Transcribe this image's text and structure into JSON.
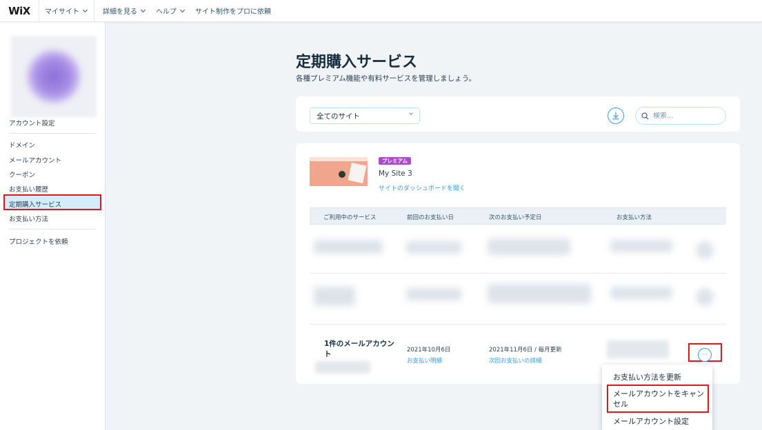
{
  "topbar": {
    "logo": "WiX",
    "my_sites": "マイサイト",
    "explore": "詳細を見る",
    "help": "ヘルプ",
    "hire": "サイト制作をプロに依頼"
  },
  "sidebar": {
    "account_settings": "アカウント設定",
    "items": [
      "ドメイン",
      "メールアカウント",
      "クーポン",
      "お支払い履歴",
      "定期購入サービス",
      "お支払い方法"
    ],
    "hire_project": "プロジェクトを依頼"
  },
  "page": {
    "title": "定期購入サービス",
    "subtitle": "各種プレミアム機能や有料サービスを管理しましょう。"
  },
  "filter": {
    "site_select": "全てのサイト",
    "search_placeholder": "検索..."
  },
  "site": {
    "badge": "プレミアム",
    "name": "My Site 3",
    "dashboard_link": "サイトのダッシュボードを開く"
  },
  "table": {
    "headers": [
      "ご利用中のサービス",
      "前回のお支払い日",
      "次のお支払い予定日",
      "お支払い方法"
    ]
  },
  "mail_row": {
    "service": "1件のメールアカウント",
    "last_payment": "2021年10月6日",
    "last_payment_link": "お支払い明細",
    "next_payment": "2021年11月6日 / 毎月更新",
    "next_payment_link": "次回お支払いの詳細",
    "more": "···"
  },
  "menu": {
    "items": [
      "お支払い方法を更新",
      "メールアカウントをキャンセル",
      "メールアカウント設定"
    ]
  },
  "colors": {
    "accent": "#3899ec",
    "highlight": "#e3131b",
    "premium_badge": "#aa4dc8"
  }
}
